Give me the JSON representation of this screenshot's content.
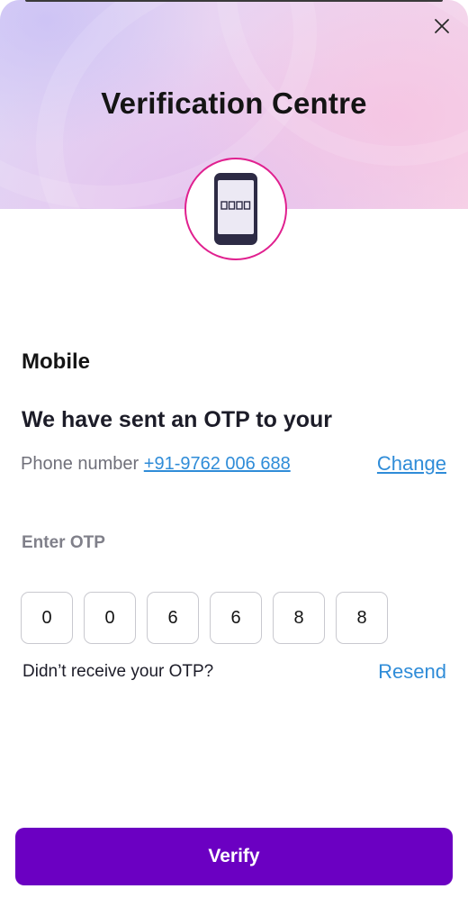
{
  "header": {
    "title": "Verification Centre",
    "close_icon": "close-icon",
    "badge_icon": "mobile-phone-icon"
  },
  "section": {
    "title": "Mobile",
    "heading": "We have sent an OTP to your",
    "phone_label": "Phone number",
    "phone_number": "+91-9762 006 688",
    "change_label": "Change"
  },
  "otp": {
    "label": "Enter OTP",
    "digits": [
      "0",
      "0",
      "6",
      "6",
      "8",
      "8"
    ],
    "didnt_receive": "Didn’t receive your OTP?",
    "resend_label": "Resend"
  },
  "footer": {
    "verify_label": "Verify"
  },
  "colors": {
    "accent": "#6b00c2",
    "link": "#2f8cd8",
    "badge_border": "#e0208f",
    "phone_body": "#2d2b45"
  }
}
